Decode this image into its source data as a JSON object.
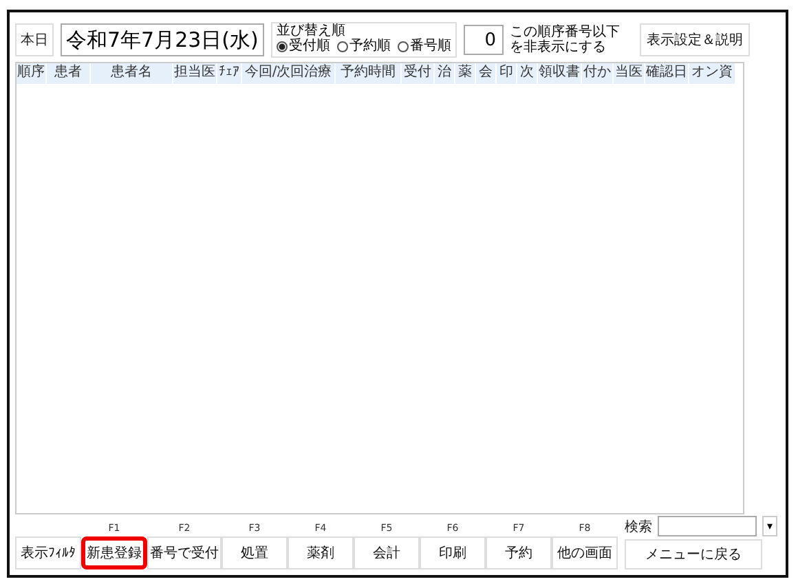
{
  "today_label": "本日",
  "date": "令和7年7月23日(水)",
  "sort_order": {
    "legend": "並び替え順",
    "options": [
      {
        "label": "受付順",
        "selected": true
      },
      {
        "label": "予約順",
        "selected": false
      },
      {
        "label": "番号順",
        "selected": false
      }
    ]
  },
  "hide_threshold": {
    "value": "0",
    "caption": "この順序番号以下を非表示にする"
  },
  "settings_button": "表示設定＆説明",
  "table": {
    "columns": [
      {
        "label": "順序"
      },
      {
        "label": "患者"
      },
      {
        "label": "患者名"
      },
      {
        "label": "担当医"
      },
      {
        "label": "ﾁｪｱ"
      },
      {
        "label": "今回/次回治療"
      },
      {
        "label": "予約時間"
      },
      {
        "label": "受付"
      },
      {
        "label": "治"
      },
      {
        "label": "薬"
      },
      {
        "label": "会"
      },
      {
        "label": "印"
      },
      {
        "label": "次"
      },
      {
        "label": "領収書"
      },
      {
        "label": "付か"
      },
      {
        "label": "当医"
      },
      {
        "label": "確認日"
      },
      {
        "label": "オン資"
      }
    ]
  },
  "function_keys": [
    {
      "label": "表示ﾌｨﾙﾀ",
      "highlighted": false
    },
    {
      "key": "F1",
      "label": "新患登録",
      "highlighted": true
    },
    {
      "key": "F2",
      "label": "番号で受付",
      "highlighted": false
    },
    {
      "key": "F3",
      "label": "処置",
      "highlighted": false
    },
    {
      "key": "F4",
      "label": "薬剤",
      "highlighted": false
    },
    {
      "key": "F5",
      "label": "会計",
      "highlighted": false
    },
    {
      "key": "F6",
      "label": "印刷",
      "highlighted": false
    },
    {
      "key": "F7",
      "label": "予約",
      "highlighted": false
    },
    {
      "key": "F8",
      "label": "他の画面",
      "highlighted": false
    }
  ],
  "search": {
    "label": "検索",
    "dropdown": "▾"
  },
  "menu_button": "メニューに戻る"
}
